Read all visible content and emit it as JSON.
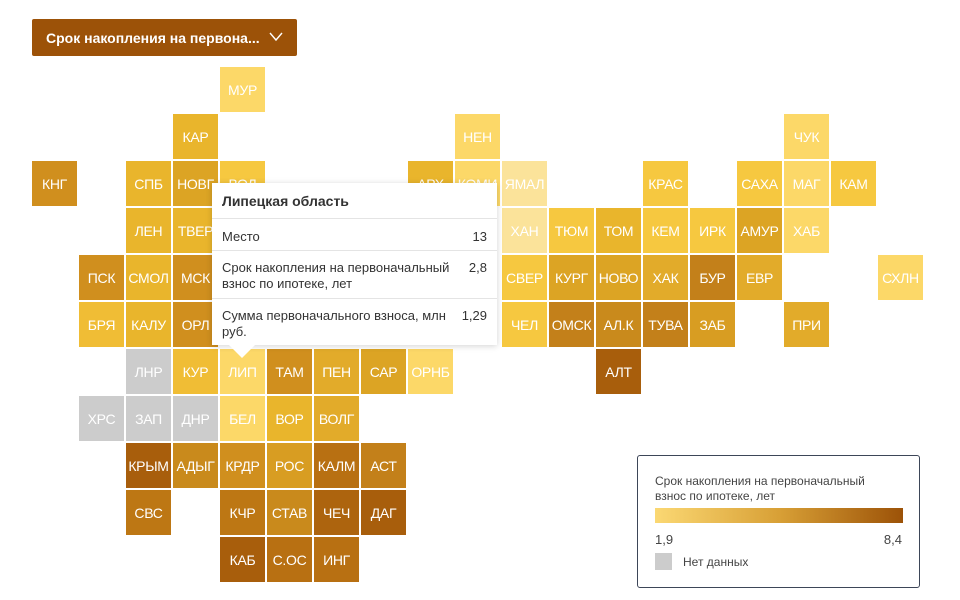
{
  "dropdown": {
    "label": "Срок накопления на первона...",
    "icon": "chevron-down-icon"
  },
  "chart_data": {
    "type": "heatmap",
    "subtype": "tile-grid-map",
    "color_scale": {
      "min": 1.9,
      "max": 8.4,
      "min_label": "1,9",
      "max_label": "8,4",
      "colors": [
        "#fbd873",
        "#9c5208"
      ]
    },
    "no_data_color": "#cccccc",
    "tiles": [
      {
        "label": "МУР",
        "row": 0,
        "col": 4,
        "color": "#fcd868"
      },
      {
        "label": "КАР",
        "row": 1,
        "col": 3,
        "color": "#e9b52c"
      },
      {
        "label": "НЕН",
        "row": 1,
        "col": 9,
        "color": "#fcd868"
      },
      {
        "label": "ЧУК",
        "row": 1,
        "col": 16,
        "color": "#fcd868"
      },
      {
        "label": "КНГ",
        "row": 2,
        "col": 0,
        "color": "#d08f1e"
      },
      {
        "label": "СПБ",
        "row": 2,
        "col": 2,
        "color": "#e9b52c"
      },
      {
        "label": "НОВГ",
        "row": 2,
        "col": 3,
        "color": "#dca424"
      },
      {
        "label": "ВОЛ",
        "row": 2,
        "col": 4,
        "color": "#f6c840"
      },
      {
        "label": "АРХ",
        "row": 2,
        "col": 8,
        "color": "#e9b52c"
      },
      {
        "label": "КОМИ",
        "row": 2,
        "col": 9,
        "color": "#fcd868"
      },
      {
        "label": "ЯМАЛ",
        "row": 2,
        "col": 10,
        "color": "#fbe39a"
      },
      {
        "label": "КРАС",
        "row": 2,
        "col": 13,
        "color": "#f6c840"
      },
      {
        "label": "САХА",
        "row": 2,
        "col": 15,
        "color": "#f6c840"
      },
      {
        "label": "МАГ",
        "row": 2,
        "col": 16,
        "color": "#fcd868"
      },
      {
        "label": "КАМ",
        "row": 2,
        "col": 17,
        "color": "#f6c840"
      },
      {
        "label": "ЛЕН",
        "row": 3,
        "col": 2,
        "color": "#e9b52c"
      },
      {
        "label": "ТВЕР",
        "row": 3,
        "col": 3,
        "color": "#e9b52c"
      },
      {
        "label": "ХАН",
        "row": 3,
        "col": 10,
        "color": "#fbe39a"
      },
      {
        "label": "ТЮМ",
        "row": 3,
        "col": 11,
        "color": "#f6c840"
      },
      {
        "label": "ТОМ",
        "row": 3,
        "col": 12,
        "color": "#e9b52c"
      },
      {
        "label": "КЕМ",
        "row": 3,
        "col": 13,
        "color": "#f6c840"
      },
      {
        "label": "ИРК",
        "row": 3,
        "col": 14,
        "color": "#f6c840"
      },
      {
        "label": "АМУР",
        "row": 3,
        "col": 15,
        "color": "#dca424"
      },
      {
        "label": "ХАБ",
        "row": 3,
        "col": 16,
        "color": "#fcd868"
      },
      {
        "label": "ПСК",
        "row": 4,
        "col": 1,
        "color": "#d08f1e"
      },
      {
        "label": "СМОЛ",
        "row": 4,
        "col": 2,
        "color": "#e9b52c"
      },
      {
        "label": "МСК",
        "row": 4,
        "col": 3,
        "color": "#d08f1e"
      },
      {
        "label": "СВЕР",
        "row": 4,
        "col": 10,
        "color": "#f6c840"
      },
      {
        "label": "КУРГ",
        "row": 4,
        "col": 11,
        "color": "#dca424"
      },
      {
        "label": "НОВО",
        "row": 4,
        "col": 12,
        "color": "#dca424"
      },
      {
        "label": "ХАК",
        "row": 4,
        "col": 13,
        "color": "#e2ab2a"
      },
      {
        "label": "БУР",
        "row": 4,
        "col": 14,
        "color": "#c3801a"
      },
      {
        "label": "ЕВР",
        "row": 4,
        "col": 15,
        "color": "#e2ab2a"
      },
      {
        "label": "СХЛН",
        "row": 4,
        "col": 18,
        "color": "#fcd868"
      },
      {
        "label": "БРЯ",
        "row": 5,
        "col": 1,
        "color": "#f0bd35"
      },
      {
        "label": "КАЛУ",
        "row": 5,
        "col": 2,
        "color": "#e9b52c"
      },
      {
        "label": "ОРЛ",
        "row": 5,
        "col": 3,
        "color": "#d08f1e"
      },
      {
        "label": "ЧЕЛ",
        "row": 5,
        "col": 10,
        "color": "#f6c840"
      },
      {
        "label": "ОМСК",
        "row": 5,
        "col": 11,
        "color": "#c3801a"
      },
      {
        "label": "АЛ.К",
        "row": 5,
        "col": 12,
        "color": "#c98a1c"
      },
      {
        "label": "ТУВА",
        "row": 5,
        "col": 13,
        "color": "#c3801a"
      },
      {
        "label": "ЗАБ",
        "row": 5,
        "col": 14,
        "color": "#d89d22"
      },
      {
        "label": "ПРИ",
        "row": 5,
        "col": 16,
        "color": "#e2ab2a"
      },
      {
        "label": "ЛНР",
        "row": 6,
        "col": 2,
        "color": "#cccccc"
      },
      {
        "label": "КУР",
        "row": 6,
        "col": 3,
        "color": "#f0bd35"
      },
      {
        "label": "ЛИП",
        "row": 6,
        "col": 4,
        "color": "#fcd868"
      },
      {
        "label": "ТАМ",
        "row": 6,
        "col": 5,
        "color": "#d08f1e"
      },
      {
        "label": "ПЕН",
        "row": 6,
        "col": 6,
        "color": "#e2ab2a"
      },
      {
        "label": "САР",
        "row": 6,
        "col": 7,
        "color": "#dca424"
      },
      {
        "label": "ОРНБ",
        "row": 6,
        "col": 8,
        "color": "#fcd868"
      },
      {
        "label": "АЛТ",
        "row": 6,
        "col": 12,
        "color": "#a85e0c"
      },
      {
        "label": "ХРС",
        "row": 7,
        "col": 1,
        "color": "#cccccc"
      },
      {
        "label": "ЗАП",
        "row": 7,
        "col": 2,
        "color": "#cccccc"
      },
      {
        "label": "ДНР",
        "row": 7,
        "col": 3,
        "color": "#cccccc"
      },
      {
        "label": "БЕЛ",
        "row": 7,
        "col": 4,
        "color": "#fcd868"
      },
      {
        "label": "ВОР",
        "row": 7,
        "col": 5,
        "color": "#e9b52c"
      },
      {
        "label": "ВОЛГ",
        "row": 7,
        "col": 6,
        "color": "#e2ab2a"
      },
      {
        "label": "КРЫМ",
        "row": 8,
        "col": 2,
        "color": "#a85e0c"
      },
      {
        "label": "АДЫГ",
        "row": 8,
        "col": 3,
        "color": "#c98a1c"
      },
      {
        "label": "КРДР",
        "row": 8,
        "col": 4,
        "color": "#d08f1e"
      },
      {
        "label": "РОС",
        "row": 8,
        "col": 5,
        "color": "#d89d22"
      },
      {
        "label": "КАЛМ",
        "row": 8,
        "col": 6,
        "color": "#b87012"
      },
      {
        "label": "АСТ",
        "row": 8,
        "col": 7,
        "color": "#c3801a"
      },
      {
        "label": "СВС",
        "row": 9,
        "col": 2,
        "color": "#bd7714"
      },
      {
        "label": "КЧР",
        "row": 9,
        "col": 4,
        "color": "#bd7714"
      },
      {
        "label": "СТАВ",
        "row": 9,
        "col": 5,
        "color": "#c98a1c"
      },
      {
        "label": "ЧЕЧ",
        "row": 9,
        "col": 6,
        "color": "#ad640e"
      },
      {
        "label": "ДАГ",
        "row": 9,
        "col": 7,
        "color": "#a85e0c"
      },
      {
        "label": "КАБ",
        "row": 10,
        "col": 4,
        "color": "#a85e0c"
      },
      {
        "label": "С.ОС",
        "row": 10,
        "col": 5,
        "color": "#b87012"
      },
      {
        "label": "ИНГ",
        "row": 10,
        "col": 6,
        "color": "#b87012"
      }
    ]
  },
  "tooltip": {
    "title": "Липецкая область",
    "rows": [
      {
        "label": "Место",
        "value": "13"
      },
      {
        "label": "Срок накопления на первоначальный взнос по ипотеке, лет",
        "value": "2,8"
      },
      {
        "label": "Сумма первоначального взноса, млн руб.",
        "value": "1,29"
      }
    ]
  },
  "legend": {
    "title": "Срок накопления на первоначальный взнос по ипотеке, лет",
    "min": "1,9",
    "max": "8,4",
    "no_data": "Нет данных"
  }
}
